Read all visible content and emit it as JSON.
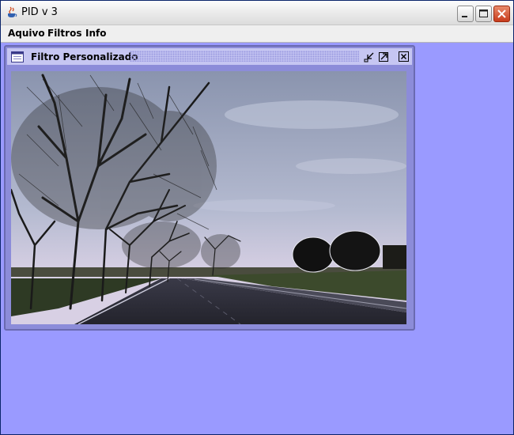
{
  "window": {
    "title": "PID v 3"
  },
  "menu": {
    "items": [
      {
        "label": "Aquivo"
      },
      {
        "label": "Filtros"
      },
      {
        "label": "Info"
      }
    ]
  },
  "internal_frame": {
    "title": "Filtro Personalizado"
  },
  "icons": {
    "app": "java-cup-icon",
    "minimize": "minimize-icon",
    "maximize": "maximize-icon",
    "close": "close-icon",
    "frame": "frame-window-icon",
    "frame_iconify": "iconify-icon",
    "frame_maximize": "maximize-icon",
    "frame_close": "close-icon"
  },
  "colors": {
    "desktop": "#9a9aff",
    "frame_title": "#c6c6f2",
    "close_button": "#d0502c"
  }
}
